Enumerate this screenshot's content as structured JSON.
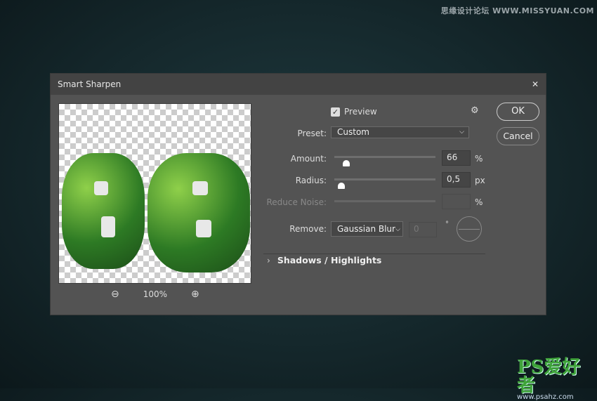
{
  "watermarks": {
    "top": "思缘设计论坛 WWW.MISSYUAN.COM",
    "bottom_logo": "PS爱好者",
    "bottom_url": "www.psahz.com"
  },
  "dialog": {
    "title": "Smart Sharpen",
    "preview_checkbox": {
      "label": "Preview",
      "checked": true
    },
    "preset": {
      "label": "Preset:",
      "value": "Custom"
    },
    "amount": {
      "label": "Amount:",
      "value": "66",
      "unit": "%",
      "slider_fraction": 0.12
    },
    "radius": {
      "label": "Radius:",
      "value": "0,5",
      "unit": "px",
      "slider_fraction": 0.07
    },
    "reduce_noise": {
      "label": "Reduce Noise:",
      "value": "",
      "unit": "%",
      "disabled": true
    },
    "remove": {
      "label": "Remove:",
      "value": "Gaussian Blur",
      "angle": "0",
      "angle_unit": "°"
    },
    "section": "Shadows / Highlights",
    "zoom_level": "100%",
    "ok": "OK",
    "cancel": "Cancel",
    "icons": [
      "gear-icon",
      "close-icon",
      "zoom-out-icon",
      "zoom-in-icon",
      "chevron-right-icon",
      "angle-dial-icon"
    ]
  }
}
